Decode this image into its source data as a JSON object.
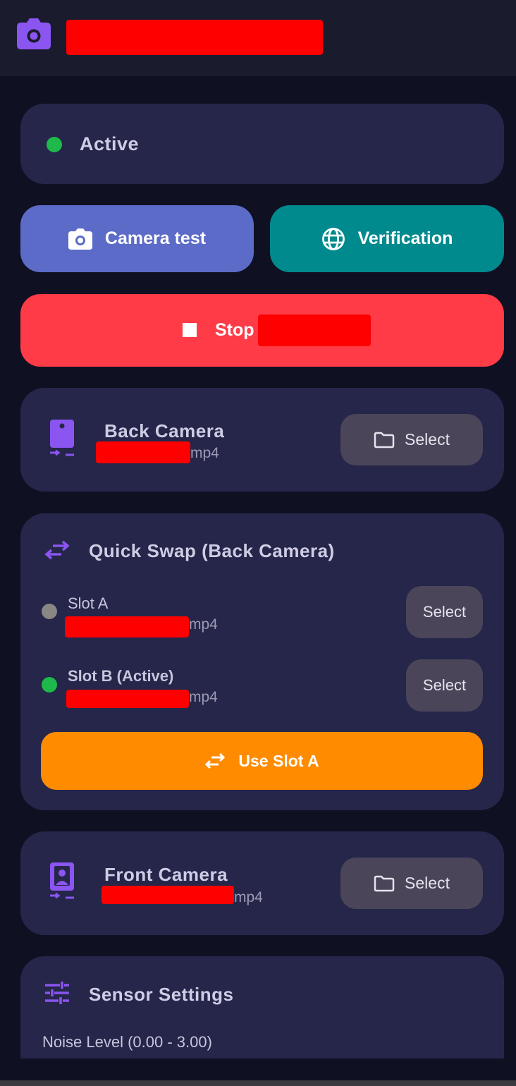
{
  "app_bar": {
    "icon": "camera-icon"
  },
  "status": {
    "label": "Active",
    "color": "#1eb94a"
  },
  "actions": {
    "camera_test_label": "Camera test",
    "verification_label": "Verification",
    "stop_label": "Stop"
  },
  "back_camera": {
    "title": "Back Camera",
    "file_suffix": "mp4",
    "select_label": "Select"
  },
  "quick_swap": {
    "title": "Quick Swap (Back Camera)",
    "slots": [
      {
        "label": "Slot A",
        "file_suffix": "mp4",
        "select_label": "Select",
        "active": false
      },
      {
        "label": "Slot B (Active)",
        "file_suffix": "mp4",
        "select_label": "Select",
        "active": true
      }
    ],
    "use_button_label": "Use Slot A"
  },
  "front_camera": {
    "title": "Front Camera",
    "file_suffix": "mp4",
    "select_label": "Select"
  },
  "sensor_settings": {
    "title": "Sensor Settings",
    "noise_label": "Noise Level (0.00 - 3.00)"
  },
  "colors": {
    "background": "#0f1022",
    "card": "#25264a",
    "accent_purple": "#8a55f0",
    "camera_test": "#5c6bc8",
    "verification": "#008a8e",
    "stop": "#ff3b47",
    "swap": "#ff8c00"
  }
}
